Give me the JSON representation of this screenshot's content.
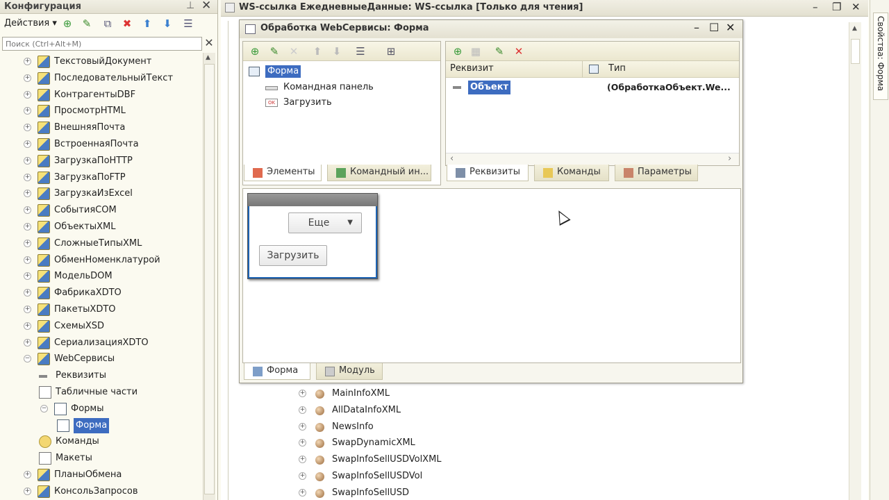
{
  "left_panel": {
    "title": "Конфигурация",
    "actions_label": "Действия ▾",
    "search_placeholder": "Поиск (Ctrl+Alt+M)",
    "tree": [
      {
        "label": "ТекстовыйДокумент",
        "expander": "+"
      },
      {
        "label": "ПоследовательныйТекст",
        "expander": "+"
      },
      {
        "label": "КонтрагентыDBF",
        "expander": "+"
      },
      {
        "label": "ПросмотрHTML",
        "expander": "+"
      },
      {
        "label": "ВнешняяПочта",
        "expander": "+"
      },
      {
        "label": "ВстроеннаяПочта",
        "expander": "+"
      },
      {
        "label": "ЗагрузкаПоHTTP",
        "expander": "+"
      },
      {
        "label": "ЗагрузкаПоFTP",
        "expander": "+"
      },
      {
        "label": "ЗагрузкаИзExcel",
        "expander": "+"
      },
      {
        "label": "СобытияCOM",
        "expander": "+"
      },
      {
        "label": "ОбъектыXML",
        "expander": "+"
      },
      {
        "label": "СложныеТипыXML",
        "expander": "+"
      },
      {
        "label": "ОбменНоменклатурой",
        "expander": "+"
      },
      {
        "label": "МодельDOM",
        "expander": "+"
      },
      {
        "label": "ФабрикаXDTO",
        "expander": "+"
      },
      {
        "label": "ПакетыXDTO",
        "expander": "+"
      },
      {
        "label": "СхемыXSD",
        "expander": "+"
      },
      {
        "label": "СериализацияXDTO",
        "expander": "+"
      },
      {
        "label": "WebСервисы",
        "expander": "−"
      },
      {
        "label": "Реквизиты",
        "expander": ""
      },
      {
        "label": "Табличные части",
        "expander": ""
      },
      {
        "label": "Формы",
        "expander": "−"
      },
      {
        "label": "Форма",
        "expander": ""
      },
      {
        "label": "Команды",
        "expander": ""
      },
      {
        "label": "Макеты",
        "expander": ""
      },
      {
        "label": "ПланыОбмена",
        "expander": "+"
      },
      {
        "label": "КонсольЗапросов",
        "expander": "+"
      }
    ]
  },
  "ws_window": {
    "title": "WS-ссылка ЕжедневныеДанные: WS-ссылка [Только для чтения]",
    "operations": [
      "MainInfoXML",
      "AllDataInfoXML",
      "NewsInfo",
      "SwapDynamicXML",
      "SwapInfoSellUSDVolXML",
      "SwapInfoSellUSDVol",
      "SwapInfoSellUSD"
    ]
  },
  "properties_tab": "Свойства: Форма",
  "form_window": {
    "title": "Обработка WebСервисы: Форма",
    "elements_tree": {
      "root": "Форма",
      "items": [
        "Командная панель",
        "Загрузить"
      ]
    },
    "left_tabs": [
      "Элементы",
      "Командный ин..."
    ],
    "attrs_header": {
      "col1": "Реквизит",
      "col2": "Тип"
    },
    "attrs_rows": [
      {
        "name": "Объект",
        "type": "(ОбработкаОбъект.We..."
      }
    ],
    "right_tabs": [
      "Реквизиты",
      "Команды",
      "Параметры"
    ],
    "preview": {
      "more_button": "Еще",
      "load_button": "Загрузить"
    },
    "bottom_tabs": [
      "Форма",
      "Модуль"
    ]
  }
}
